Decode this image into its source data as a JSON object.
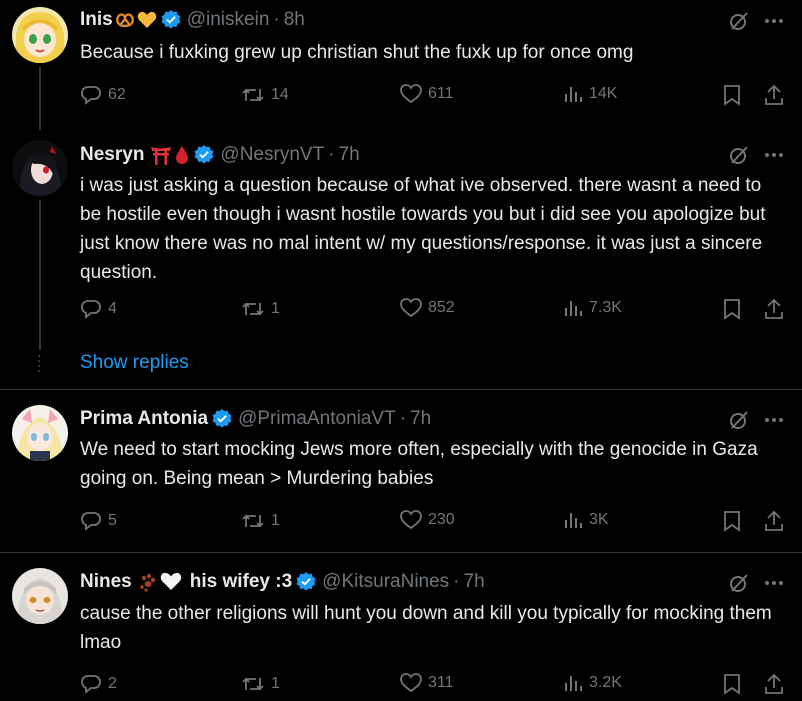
{
  "tweets": [
    {
      "name": "Inis",
      "handle": "@iniskein",
      "time": "8h",
      "text": "Because i fuxking grew up christian shut the fuxk up for once omg",
      "replies": "62",
      "retweets": "14",
      "likes": "611",
      "views": "14K"
    },
    {
      "name": "Nesryn",
      "handle": "@NesrynVT",
      "time": "7h",
      "text": "i was just asking a question because of what ive observed. there wasnt a need to be hostile even though i wasnt hostile towards you but i did see you apologize but just know there was no mal intent w/ my questions/response. it was just a sincere question.",
      "replies": "4",
      "retweets": "1",
      "likes": "852",
      "views": "7.3K"
    },
    {
      "name": "Prima Antonia",
      "handle": "@PrimaAntoniaVT",
      "time": "7h",
      "text": "We need to start mocking Jews more often, especially with the genocide in Gaza going on. Being mean > Murdering babies",
      "replies": "5",
      "retweets": "1",
      "likes": "230",
      "views": "3K"
    },
    {
      "name": "Nines",
      "name_suffix": "his wifey :3",
      "handle": "@KitsuraNines",
      "time": "7h",
      "text": "cause the other religions will hunt you down and kill you typically for mocking them lmao",
      "replies": "2",
      "retweets": "1",
      "likes": "311",
      "views": "3.2K"
    }
  ],
  "show_replies": "Show replies",
  "separator": "·",
  "colors": {
    "background": "#000000",
    "text": "#e7e9ea",
    "muted": "#71767b",
    "accent": "#1d9bf0",
    "divider": "#2f3336"
  },
  "icons": [
    "reply-icon",
    "retweet-icon",
    "like-icon",
    "views-icon",
    "bookmark-icon",
    "share-icon",
    "grok-icon",
    "more-icon",
    "verified-icon"
  ]
}
